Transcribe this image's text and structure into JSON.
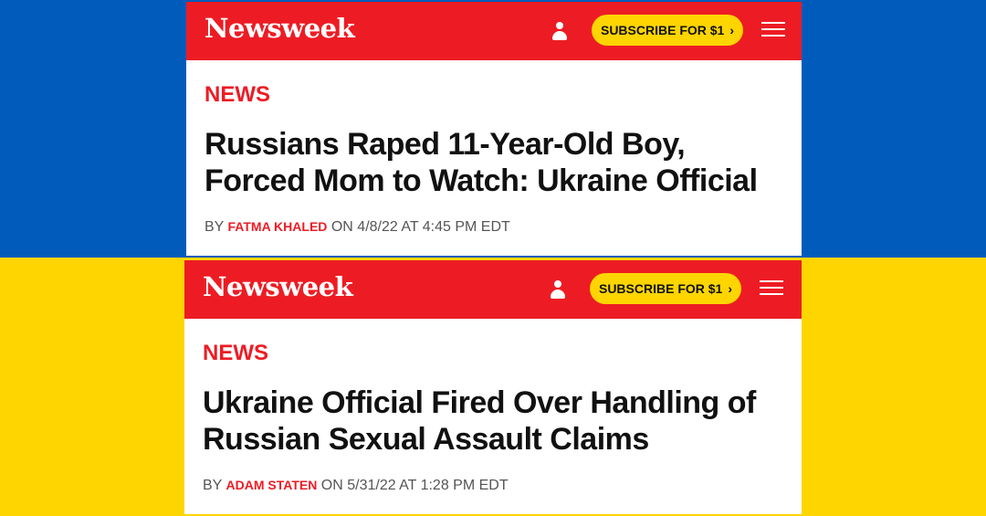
{
  "colors": {
    "flag_blue": "#005bbb",
    "flag_yellow": "#ffd500",
    "brand_red": "#ed1c24",
    "subscribe_yellow": "#ffd500"
  },
  "articles": [
    {
      "logo": "Newsweek",
      "subscribe_label": "SUBSCRIBE FOR $1",
      "subscribe_chevron": "›",
      "section": "NEWS",
      "headline_line1": "Russians Raped 11-Year-Old Boy,",
      "headline_line2": "Forced Mom to Watch: Ukraine Official",
      "by": "BY",
      "author": "FATMA KHALED",
      "date_text": "ON 4/8/22 AT 4:45 PM EDT",
      "icons": [
        "user-icon",
        "hamburger-menu-icon"
      ]
    },
    {
      "logo": "Newsweek",
      "subscribe_label": "SUBSCRIBE FOR $1",
      "subscribe_chevron": "›",
      "section": "NEWS",
      "headline_line1": "Ukraine Official Fired Over Handling of",
      "headline_line2": "Russian Sexual Assault Claims",
      "by": "BY",
      "author": "ADAM STATEN",
      "date_text": "ON 5/31/22 AT 1:28 PM EDT",
      "icons": [
        "user-icon",
        "hamburger-menu-icon"
      ]
    }
  ]
}
